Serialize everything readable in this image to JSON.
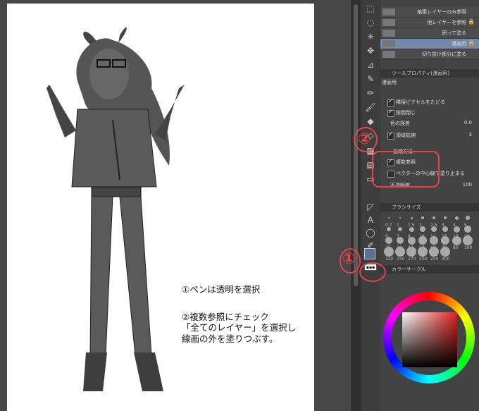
{
  "canvas": {
    "instructions": [
      "①ペンは透明を選択",
      "②複数参照にチェック\n「全てのレイヤー」を選択し\n線画の外を塗りつぶす。"
    ]
  },
  "layers": [
    {
      "name": "編集レイヤーのみ参照",
      "lock": ""
    },
    {
      "name": "他レイヤーを参照",
      "lock": "🔒"
    },
    {
      "name": "囲って塗る",
      "lock": ""
    },
    {
      "name": "漫画用",
      "lock": "🔒"
    },
    {
      "name": "切り抜け部分に塗る",
      "lock": ""
    }
  ],
  "tool_property": {
    "header": "ツールプロパティ[漫画用]",
    "subtool": "漫画用",
    "options": [
      {
        "label": "隣接ピクセルをたどる",
        "checked": true
      },
      {
        "label": "隙間閉じ",
        "checked": true
      },
      {
        "label": "色の誤差",
        "checked": false,
        "value": "0.0"
      },
      {
        "label": "領域拡縮",
        "checked": true,
        "value": "3"
      },
      {
        "label": "拡縮方法",
        "checked": false
      },
      {
        "label": "複数参照",
        "checked": true
      },
      {
        "label": "ベクターの中心線で塗り止まる",
        "checked": false
      },
      {
        "label": "不透明度",
        "checked": false,
        "value": "100"
      }
    ]
  },
  "brush_size": {
    "header": "ブラシサイズ",
    "sizes": [
      "0.7",
      "1",
      "1.5",
      "2",
      "2.5",
      "3",
      "4",
      "5",
      "6",
      "7",
      "8",
      "10",
      "12",
      "15",
      "17",
      "20",
      "25",
      "30",
      "40",
      "50",
      "60",
      "70",
      "80",
      "100",
      "120",
      "150",
      "170",
      "200",
      "250",
      "300"
    ]
  },
  "color_circle": {
    "header": "カラーサークル",
    "main_color": "#e02020"
  },
  "annotations": {
    "one": "①",
    "two": "②"
  }
}
